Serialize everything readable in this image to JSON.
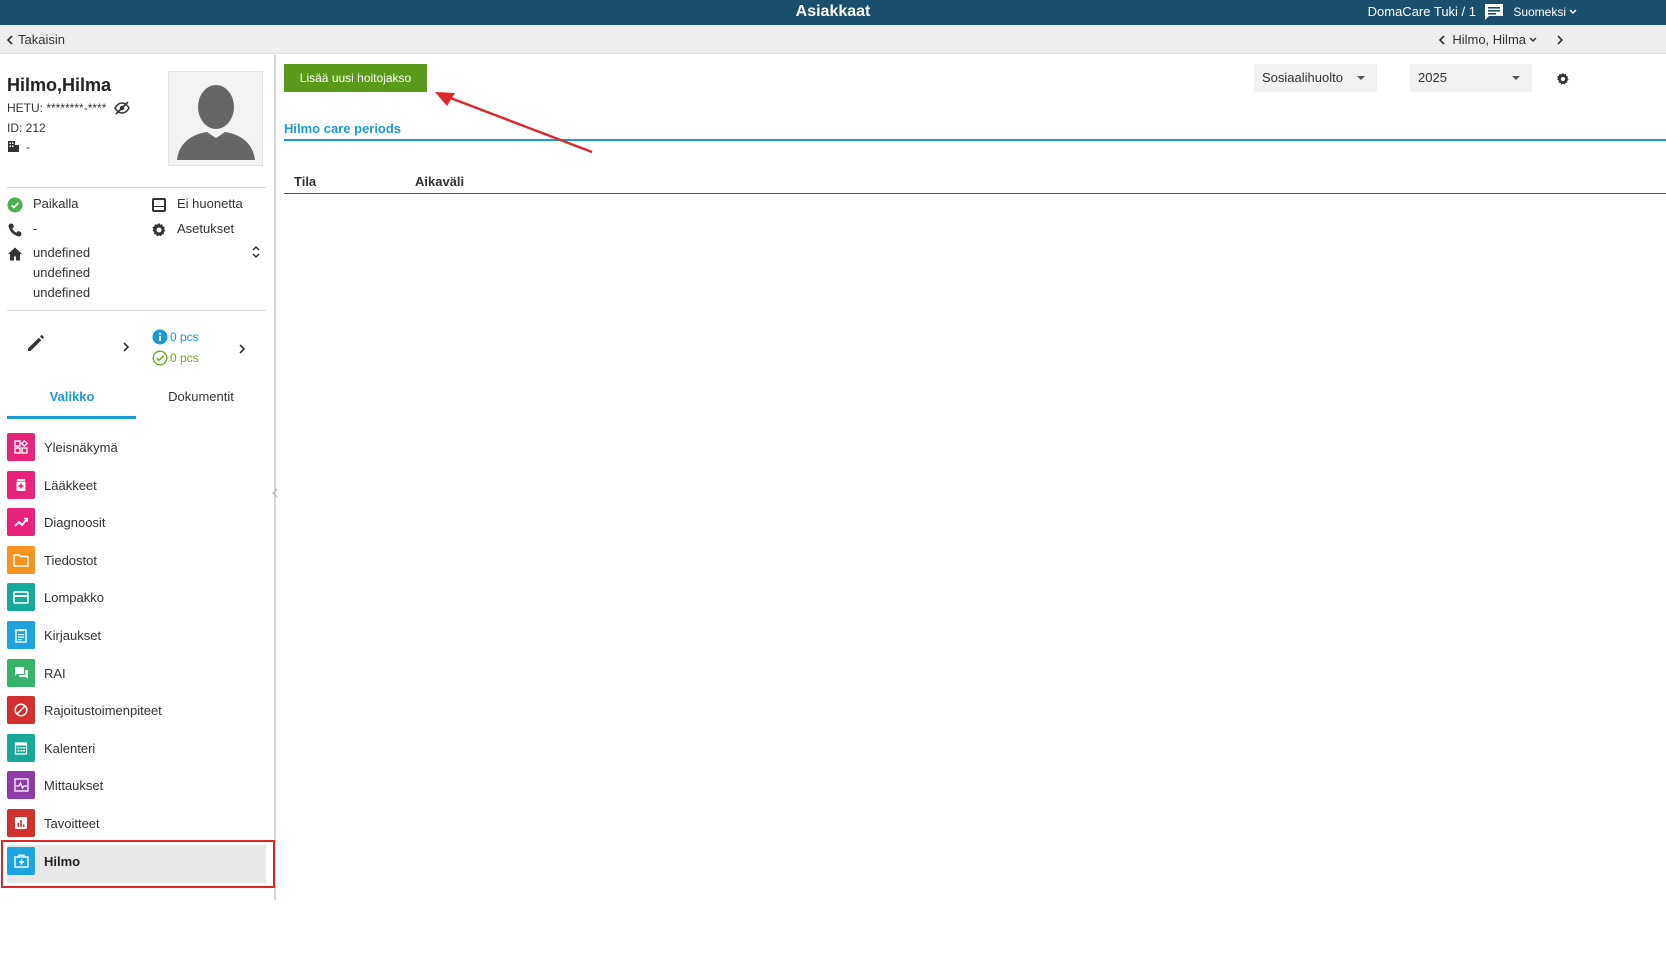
{
  "topbar": {
    "title": "Asiakkaat",
    "user": "DomaCare Tuki / 1",
    "language": "Suomeksi"
  },
  "subbar": {
    "back_label": "Takaisin",
    "current_person": "Hilmo, Hilma"
  },
  "client": {
    "name": "Hilmo,Hilma",
    "hetu": "HETU: ********-****",
    "id": "ID: 212",
    "unit": "-",
    "status": "Paikalla",
    "room": "Ei huonetta",
    "phone": "-",
    "settings": "Asetukset",
    "address": [
      "undefined",
      "undefined",
      "undefined"
    ]
  },
  "counters": {
    "info_count": "0 pcs",
    "done_count": "0 pcs"
  },
  "tabs": {
    "menu": "Valikko",
    "documents": "Dokumentit"
  },
  "menu_items": [
    {
      "label": "Yleisnäkymä",
      "color": "#e8237a"
    },
    {
      "label": "Lääkkeet",
      "color": "#e8237a"
    },
    {
      "label": "Diagnoosit",
      "color": "#e8237a"
    },
    {
      "label": "Tiedostot",
      "color": "#f7931e"
    },
    {
      "label": "Lompakko",
      "color": "#16a99a"
    },
    {
      "label": "Kirjaukset",
      "color": "#1ca3e0"
    },
    {
      "label": "RAI",
      "color": "#35b36a"
    },
    {
      "label": "Rajoitustoimenpiteet",
      "color": "#d32f2f"
    },
    {
      "label": "Kalenteri",
      "color": "#16a99a"
    },
    {
      "label": "Mittaukset",
      "color": "#8e3aa8"
    },
    {
      "label": "Tavoitteet",
      "color": "#d32f2f"
    },
    {
      "label": "Hilmo",
      "color": "#1ca3e0"
    }
  ],
  "main": {
    "add_button": "Lisää uusi hoitojakso",
    "filter_type": "Sosiaalihuolto",
    "filter_year": "2025",
    "section_title": "Hilmo care periods",
    "columns": [
      "Tila",
      "Aikaväli"
    ]
  },
  "colors": {
    "topbar": "#1b4f6b",
    "accent": "#1a9ad6",
    "button": "#5a9a1a",
    "highlight": "#e0262b"
  }
}
